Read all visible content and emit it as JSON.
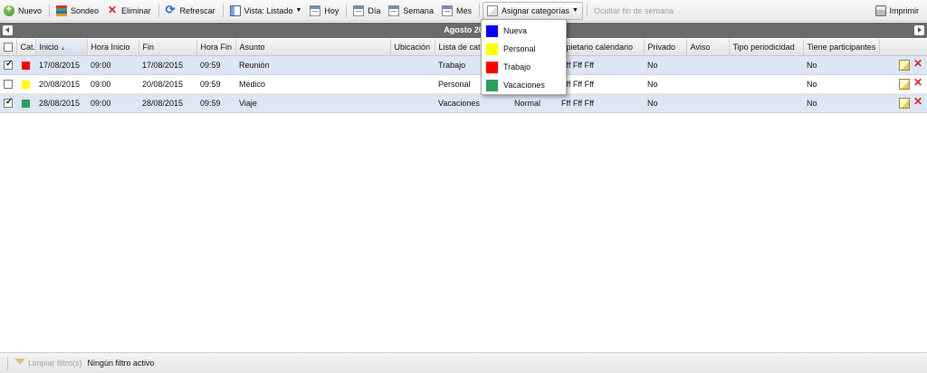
{
  "toolbar": {
    "nuevo": "Nuevo",
    "sondeo": "Sondeo",
    "eliminar": "Eliminar",
    "refrescar": "Refrescar",
    "vista": "Vista: Listado",
    "hoy": "Hoy",
    "dia": "Día",
    "semana": "Semana",
    "mes": "Mes",
    "asignar_categorias": "Asignar categorías",
    "ocultar_fin_semana": "Ocultar fin de semana",
    "imprimir": "Imprimir"
  },
  "title": "Agosto 20",
  "columns": {
    "cat": "Cat.",
    "inicio": "Inicio",
    "hora_inicio": "Hora Inicio",
    "fin": "Fin",
    "hora_fin": "Hora Fin",
    "asunto": "Asunto",
    "ubicacion": "Ubicación",
    "lista_categorias": "Lista de cate",
    "importancia": "",
    "propietario": "opietario calendario",
    "privado": "Privado",
    "aviso": "Aviso",
    "tipo_periodicidad": "Tipo periodicidad",
    "tiene_participantes": "Tiene participantes"
  },
  "rows": [
    {
      "checked": true,
      "color": "#ff0000",
      "inicio": "17/08/2015",
      "hora_inicio": "09:00",
      "fin": "17/08/2015",
      "hora_fin": "09:59",
      "asunto": "Reunión",
      "ubicacion": "",
      "lista": "Trabajo",
      "importancia": "",
      "propietario": "Fff Fff Fff",
      "privado": "No",
      "aviso": "",
      "tipo": "",
      "participantes": "No"
    },
    {
      "checked": false,
      "color": "#ffff00",
      "inicio": "20/08/2015",
      "hora_inicio": "09:00",
      "fin": "20/08/2015",
      "hora_fin": "09:59",
      "asunto": "Médico",
      "ubicacion": "",
      "lista": "Personal",
      "importancia": "",
      "propietario": "Fff Fff Fff",
      "privado": "No",
      "aviso": "",
      "tipo": "",
      "participantes": "No"
    },
    {
      "checked": true,
      "color": "#2e9e5b",
      "inicio": "28/08/2015",
      "hora_inicio": "09:00",
      "fin": "28/08/2015",
      "hora_fin": "09:59",
      "asunto": "Viaje",
      "ubicacion": "",
      "lista": "Vacaciones",
      "importancia": "Normal",
      "propietario": "Fff Fff Fff",
      "privado": "No",
      "aviso": "",
      "tipo": "",
      "participantes": "No"
    }
  ],
  "categories": [
    {
      "label": "Nueva",
      "color": "#0000ff"
    },
    {
      "label": "Personal",
      "color": "#ffff00"
    },
    {
      "label": "Trabajo",
      "color": "#ff0000"
    },
    {
      "label": "Vacaciones",
      "color": "#2e9e5b"
    }
  ],
  "status": {
    "limpiar": "Limpiar filtro(s)",
    "filtro": "Ningún filtro activo"
  }
}
